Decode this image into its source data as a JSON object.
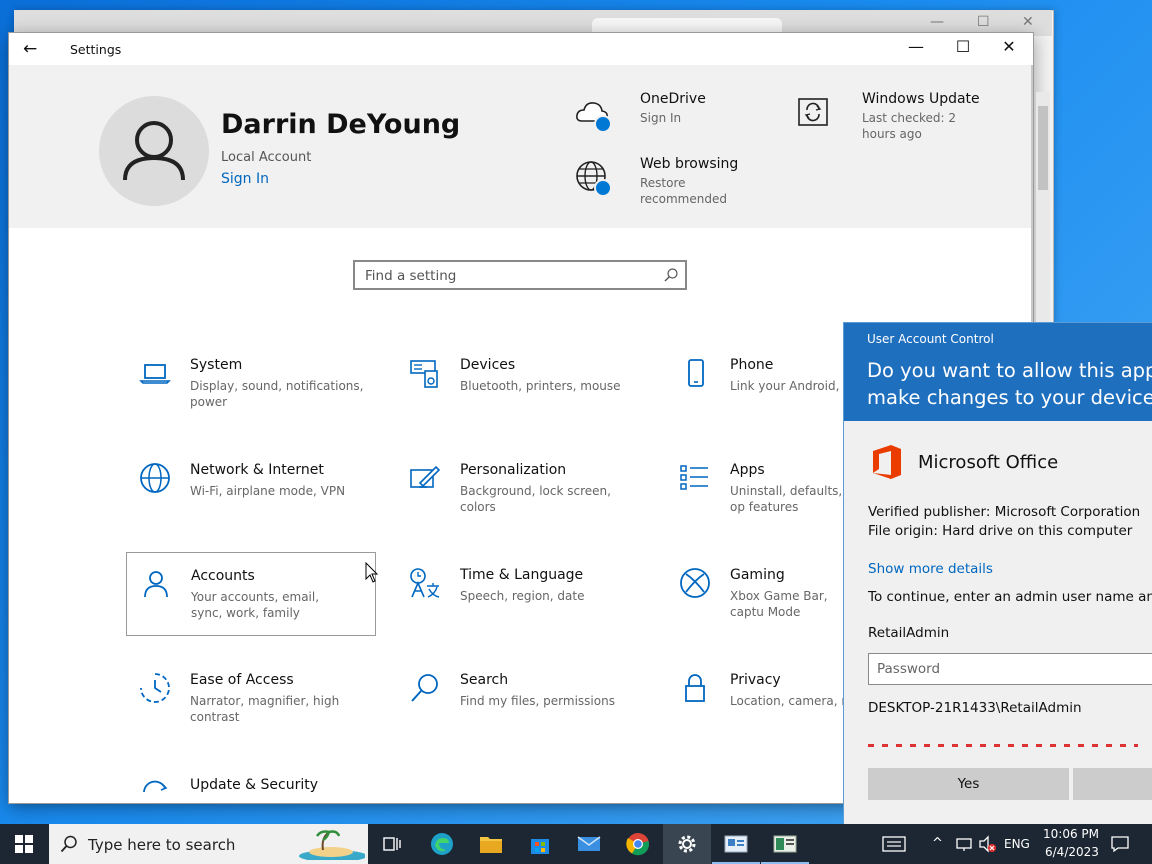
{
  "settings": {
    "window_title": "Settings",
    "user": {
      "name": "Darrin DeYoung",
      "account_type": "Local Account",
      "sign_in": "Sign In"
    },
    "services": [
      {
        "title": "OneDrive",
        "subtitle": "Sign In",
        "icon": "cloud-icon"
      },
      {
        "title": "Web browsing",
        "subtitle": "Restore recommended",
        "icon": "globe-icon"
      },
      {
        "title": "Windows Update",
        "subtitle": "Last checked: 2 hours ago",
        "icon": "sync-icon"
      }
    ],
    "search_placeholder": "Find a setting",
    "tiles": [
      {
        "title": "System",
        "subtitle": "Display, sound, notifications, power"
      },
      {
        "title": "Devices",
        "subtitle": "Bluetooth, printers, mouse"
      },
      {
        "title": "Phone",
        "subtitle": "Link your Android, iPh"
      },
      {
        "title": "Network & Internet",
        "subtitle": "Wi-Fi, airplane mode, VPN"
      },
      {
        "title": "Personalization",
        "subtitle": "Background, lock screen, colors"
      },
      {
        "title": "Apps",
        "subtitle": "Uninstall, defaults, op features"
      },
      {
        "title": "Accounts",
        "subtitle": "Your accounts, email, sync, work, family"
      },
      {
        "title": "Time & Language",
        "subtitle": "Speech, region, date"
      },
      {
        "title": "Gaming",
        "subtitle": "Xbox Game Bar, captu Mode"
      },
      {
        "title": "Ease of Access",
        "subtitle": "Narrator, magnifier, high contrast"
      },
      {
        "title": "Search",
        "subtitle": "Find my files, permissions"
      },
      {
        "title": "Privacy",
        "subtitle": "Location, camera, mic"
      },
      {
        "title": "Update & Security",
        "subtitle": ""
      }
    ]
  },
  "uac": {
    "caption": "User Account Control",
    "question": "Do you want to allow this app to make changes to your device?",
    "app_name": "Microsoft Office",
    "publisher": "Verified publisher: Microsoft Corporation",
    "origin": "File origin: Hard drive on this computer",
    "more_details": "Show more details",
    "instruction": "To continue, enter an admin user name and pa",
    "username": "RetailAdmin",
    "password_placeholder": "Password",
    "domain_user": "DESKTOP-21R1433\\RetailAdmin",
    "yes": "Yes",
    "accent_color": "#1f6fbf"
  },
  "taskbar": {
    "search_placeholder": "Type here to search",
    "language": "ENG",
    "time": "10:06 PM",
    "date": "6/4/2023"
  }
}
